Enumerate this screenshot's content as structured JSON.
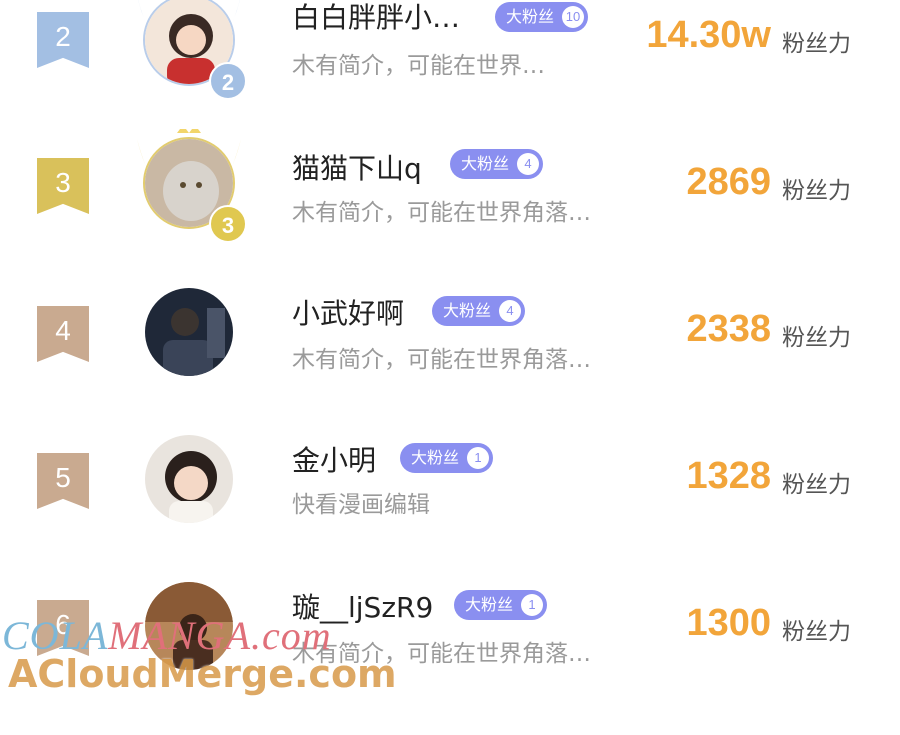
{
  "unit_label": "粉丝力",
  "fan_badge_label": "大粉丝",
  "colors": {
    "rank2": "#a3bfe3",
    "rank3": "#d9c15b",
    "rank_other": "#c9aa90",
    "fan_badge": "#8a8ff0",
    "score": "#f2a53a"
  },
  "rows": [
    {
      "rank": "2",
      "name": "白白胖胖小…",
      "fan_level": "10",
      "bio": "木有简介，可能在世界…",
      "score": "14.30w"
    },
    {
      "rank": "3",
      "name": "猫猫下山q",
      "fan_level": "4",
      "bio": "木有简介，可能在世界角落…",
      "score": "2869"
    },
    {
      "rank": "4",
      "name": "小武好啊",
      "fan_level": "4",
      "bio": "木有简介，可能在世界角落…",
      "score": "2338"
    },
    {
      "rank": "5",
      "name": "金小明",
      "fan_level": "1",
      "bio": "快看漫画编辑",
      "score": "1328"
    },
    {
      "rank": "6",
      "name": "璇__ljSzR9",
      "fan_level": "1",
      "bio": "木有简介，可能在世界角落…",
      "score": "1300"
    }
  ],
  "watermark": {
    "line1_part1": "COLA",
    "line1_part2": "MANGA",
    "line1_part3": ".com",
    "line2": "ACloudMerge.com"
  }
}
